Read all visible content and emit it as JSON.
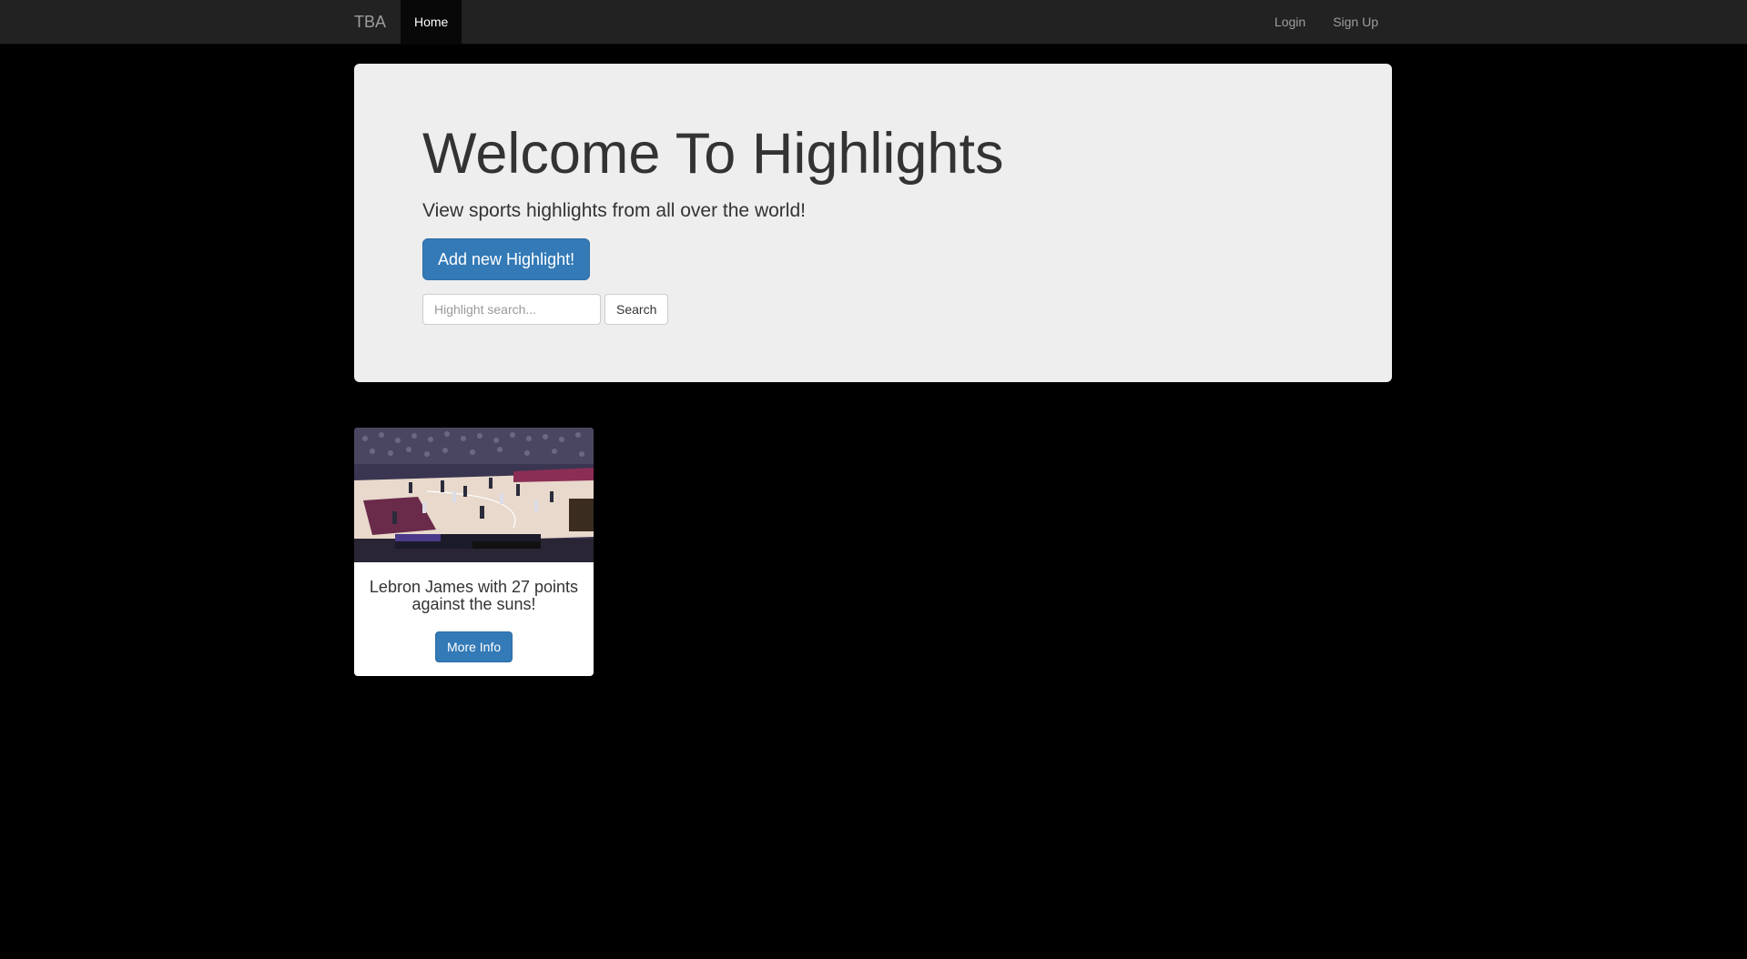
{
  "navbar": {
    "brand": "TBA",
    "home_label": "Home",
    "login_label": "Login",
    "signup_label": "Sign Up"
  },
  "jumbotron": {
    "title": "Welcome To Highlights",
    "subtitle": "View sports highlights from all over the world!",
    "add_button_label": "Add new Highlight!",
    "search_placeholder": "Highlight search...",
    "search_value": "",
    "search_button_label": "Search"
  },
  "highlights": [
    {
      "caption": "Lebron James with 27 points against the suns!",
      "thumbnail": "basketball-game-thumbnail",
      "button_label": "More Info"
    }
  ],
  "colors": {
    "page_background": "#000000",
    "navbar_background": "#222222",
    "jumbotron_background": "#eeeeee",
    "primary_button": "#337ab7",
    "court_wood": "#e8d9cc",
    "court_paint": "#6a2a4a"
  }
}
